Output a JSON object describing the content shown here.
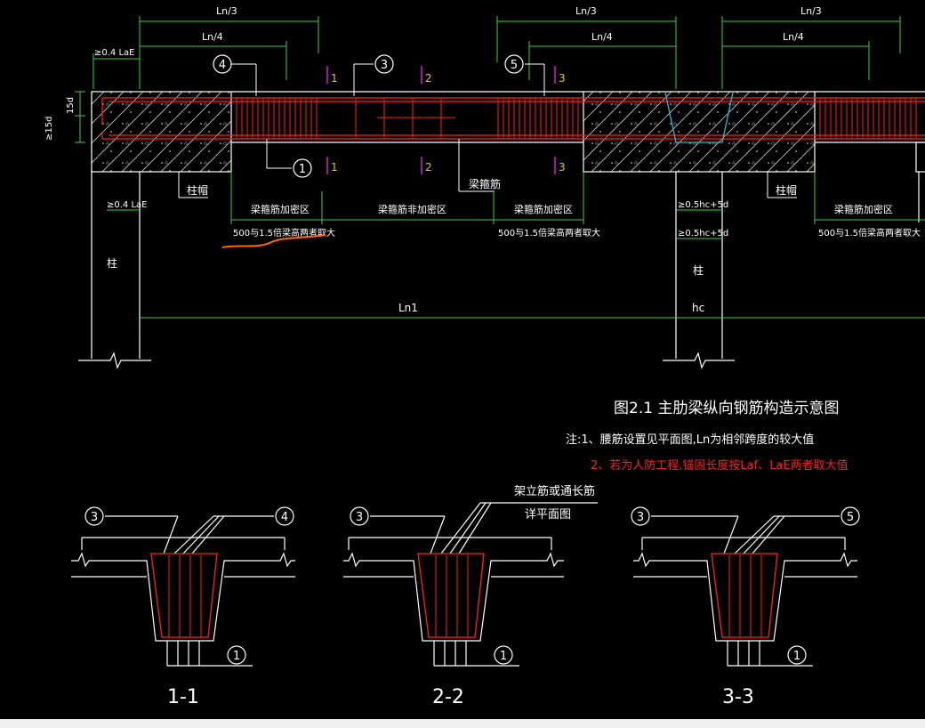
{
  "drawing": {
    "dims": {
      "ln3_left": "Ln/3",
      "ln4_left": "Ln/4",
      "lae_left": "≥0.4 LaE",
      "ln3_mid": "Ln/3",
      "ln4_mid": "Ln/4",
      "ln3_right": "Ln/3",
      "ln4_right": "Ln/4",
      "d15_a": "15d",
      "d15_b": "≥15d",
      "lae_col": "≥0.4 LaE",
      "hc5d_a": "≥0.5hc+5d",
      "hc5d_b": "≥0.5hc+5d",
      "ln1": "Ln1",
      "hc": "hc"
    },
    "callouts": {
      "c1": "1",
      "c3": "3",
      "c4": "4",
      "c5": "5",
      "s1_top": "1",
      "s2_top": "2",
      "s3_top": "3",
      "s1_bot": "1",
      "s2_bot": "2",
      "s3_bot": "3"
    },
    "labels": {
      "col_cap_left": "柱帽",
      "col_cap_right": "柱帽",
      "stirrup": "梁箍筋",
      "zone_dense_left": "梁箍筋加密区",
      "zone_normal": "梁箍筋非加密区",
      "zone_dense_mid": "梁箍筋加密区",
      "zone_dense_right": "梁箍筋加密区",
      "zone_len_left": "500与1.5倍梁高两者取大",
      "zone_len_mid": "500与1.5倍梁高两者取大",
      "zone_len_right": "500与1.5倍梁高两者取大",
      "column_left": "柱",
      "column_right": "柱"
    },
    "title": "图2.1    主肋梁纵向钢筋构造示意图",
    "notes": {
      "note1": "注:1、腰筋设置见平面图,Ln为相邻跨度的较大值",
      "note2": "2、若为人防工程,锚固长度按Laf、LaE两者取大值"
    },
    "sections": {
      "frame_bar_label_1": "架立筋或通长筋",
      "frame_bar_label_2": "详平面图",
      "s1_name": "1-1",
      "s2_name": "2-2",
      "s3_name": "3-3",
      "s1_left": "3",
      "s1_right": "4",
      "s1_bottom": "1",
      "s2_left": "3",
      "s2_bottom": "1",
      "s3_left": "3",
      "s3_right": "5",
      "s3_bottom": "1"
    },
    "colors": {
      "line": "#ffffff",
      "rebar": "#ff2020",
      "section_mark": "#d020d0",
      "section_mark_y": "#e0d000",
      "cyan": "#20c0d0",
      "highlight": "#ff6a00",
      "note_red": "#ff2020",
      "dim_green": "#40d040"
    }
  }
}
